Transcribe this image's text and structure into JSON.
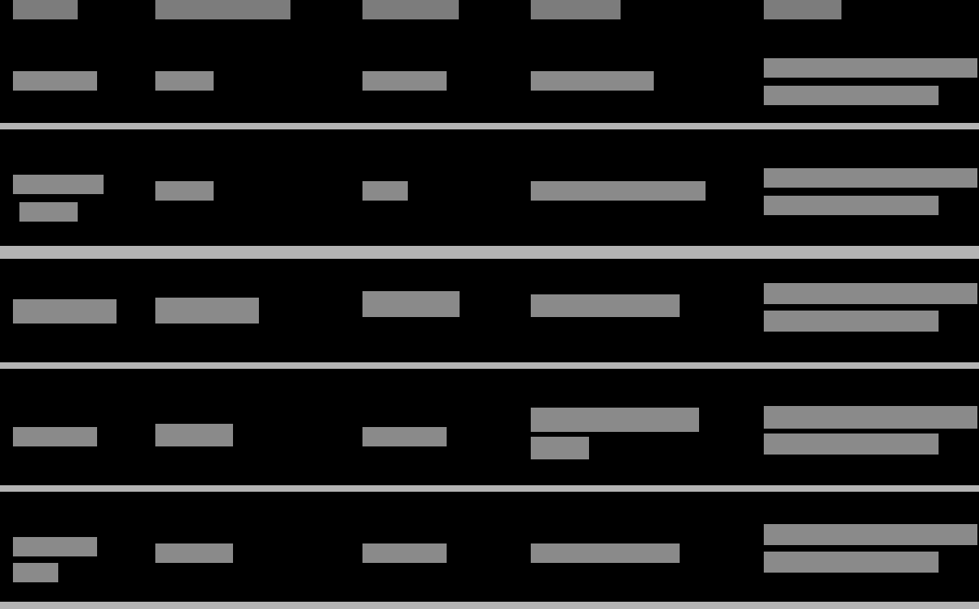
{
  "table": {
    "columns": [
      "",
      "",
      "",
      "",
      ""
    ],
    "rows": [
      {
        "cells": [
          "",
          "",
          "",
          "",
          ""
        ]
      },
      {
        "cells": [
          "",
          "",
          "",
          "",
          ""
        ]
      },
      {
        "cells": [
          "",
          "",
          "",
          "",
          ""
        ]
      },
      {
        "cells": [
          "",
          "",
          "",
          "",
          ""
        ]
      },
      {
        "cells": [
          "",
          "",
          "",
          "",
          ""
        ]
      }
    ]
  },
  "colors": {
    "background": "#000000",
    "redacted_text": "#8a8a8a",
    "header_redacted": "#7c7c7c",
    "row_divider": "#b4b4b4"
  }
}
